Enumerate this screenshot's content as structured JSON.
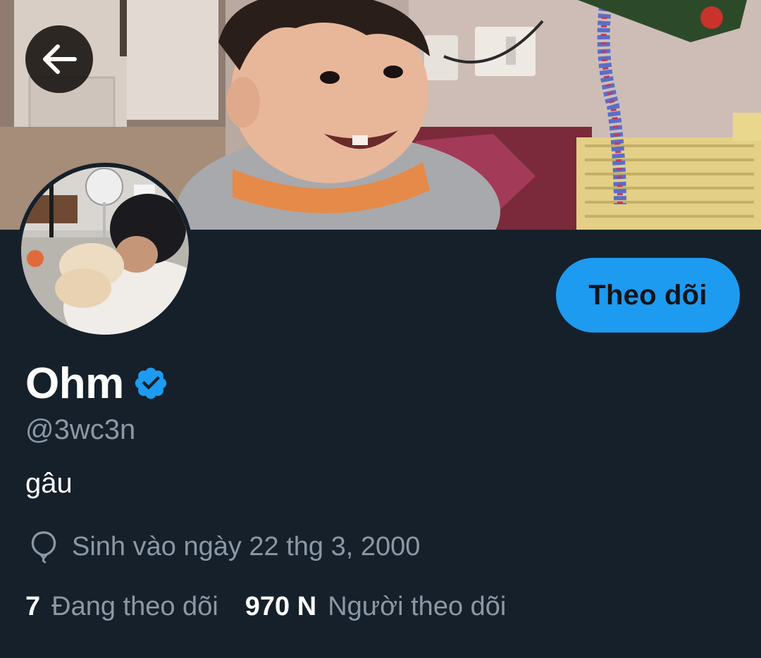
{
  "profile": {
    "display_name": "Ohm",
    "verified": true,
    "handle": "@3wc3n",
    "bio": "gâu",
    "birth_text": "Sinh vào ngày 22 thg 3, 2000"
  },
  "actions": {
    "follow_label": "Theo dõi"
  },
  "stats": {
    "following_count": "7",
    "following_label": "Đang theo dõi",
    "followers_count": "970 N",
    "followers_label": "Người theo dõi"
  },
  "icons": {
    "back": "back-arrow-icon",
    "verified": "verified-badge-icon",
    "birthday": "balloon-icon"
  },
  "colors": {
    "background": "#15202b",
    "accent": "#1d9bf0",
    "text_primary": "#ffffff",
    "text_secondary": "#8b98a5"
  }
}
